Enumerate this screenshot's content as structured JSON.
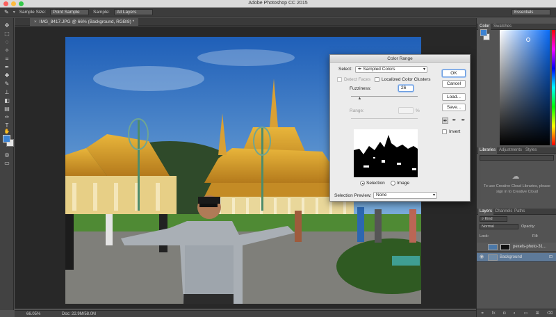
{
  "app": {
    "title": "Adobe Photoshop CC 2015"
  },
  "options_bar": {
    "sample_size_label": "Sample Size:",
    "sample_size_value": "Point Sample",
    "sample_label": "Sample:",
    "sample_value": "All Layers",
    "workspace": "Essentials"
  },
  "document": {
    "tab_label": "IMG_8417.JPG @ 66% (Background, RGB/8) *",
    "zoom": "66.05%",
    "doc_size": "Doc: 22.9M/58.0M"
  },
  "panels": {
    "color_tabs": [
      "Color",
      "Swatches"
    ],
    "library_tabs": [
      "Libraries",
      "Adjustments",
      "Styles"
    ],
    "library_message": "To use Creative Cloud Libraries, please sign in to Creative Cloud",
    "layer_tabs": [
      "Layers",
      "Channels",
      "Paths"
    ],
    "filter_kind": "Kind",
    "blend_mode": "Normal",
    "opacity_label": "Opacity:",
    "lock_label": "Lock:",
    "fill_label": "Fill:",
    "layers": [
      {
        "name": "pexels-photo-31..."
      },
      {
        "name": "Background"
      }
    ]
  },
  "dialog": {
    "title": "Color Range",
    "select_label": "Select:",
    "select_value": "Sampled Colors",
    "detect_faces": "Detect Faces",
    "localized": "Localized Color Clusters",
    "fuzziness_label": "Fuzziness:",
    "fuzziness_value": "26",
    "fuzziness_fraction": 0.13,
    "range_label": "Range:",
    "range_unit": "%",
    "selection_radio": "Selection",
    "image_radio": "Image",
    "preview_label": "Selection Preview:",
    "preview_value": "None",
    "ok": "OK",
    "cancel": "Cancel",
    "load": "Load...",
    "save": "Save...",
    "invert": "Invert"
  },
  "colors": {
    "foreground": "#3b82d2",
    "background": "#e6e6e6",
    "accent": "#6d9ee0"
  }
}
